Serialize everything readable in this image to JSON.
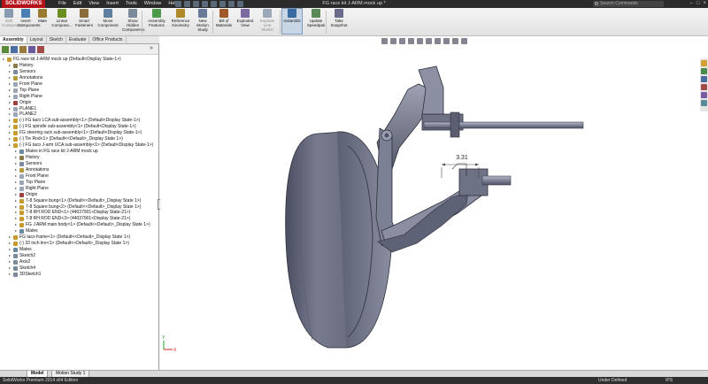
{
  "app": {
    "logo": "SOLIDWORKS",
    "doc_title": "FG race kit J-ARM mock up *",
    "search_placeholder": "Search Commands",
    "min": "–",
    "max": "□",
    "close": "×"
  },
  "menu": [
    "File",
    "Edit",
    "View",
    "Insert",
    "Tools",
    "Window",
    "Help"
  ],
  "ribbon": [
    {
      "label": "Edit\nComponent",
      "dim": true,
      "color": "#8a9bb0"
    },
    {
      "label": "Insert\nComponents",
      "color": "#4a7fb5"
    },
    {
      "label": "Mate",
      "color": "#9a7b2f"
    },
    {
      "label": "Linear\nCompone...",
      "color": "#6b8e23"
    },
    {
      "label": "Smart\nFasteners",
      "color": "#8b6b3a"
    },
    {
      "label": "Move\nComponent",
      "color": "#5f7fa0"
    },
    {
      "label": "Show\nHidden\nComponents",
      "color": "#7a8a9a"
    },
    {
      "label": "Assembly\nFeatures",
      "color": "#4c9a4c"
    },
    {
      "label": "Reference\nGeometry",
      "color": "#b08a2a"
    },
    {
      "label": "New\nMotion\nStudy",
      "color": "#6a7a9a"
    },
    {
      "label": "Bill of\nMaterials",
      "color": "#a05a2a"
    },
    {
      "label": "Exploded\nView",
      "color": "#7a6aa0"
    },
    {
      "label": "Explode\nLine\nSketch",
      "dim": true,
      "color": "#9aa8b8"
    },
    {
      "label": "Instant3D",
      "active": true,
      "color": "#3a6aa0"
    },
    {
      "label": "Update\nSpeedpak",
      "color": "#5a8a5a"
    },
    {
      "label": "Take\nSnapshot",
      "color": "#6a6a8a"
    }
  ],
  "tabs": [
    "Assembly",
    "Layout",
    "Sketch",
    "Evaluate",
    "Office Products"
  ],
  "tree": [
    {
      "label": "FG race kit J-ARM mock up  (Default<Display State-1>)",
      "lvl": 0,
      "color": "#c99a2e"
    },
    {
      "label": "History",
      "lvl": 1,
      "color": "#8a7a4a"
    },
    {
      "label": "Sensors",
      "lvl": 1,
      "color": "#7a8aa0"
    },
    {
      "label": "Annotations",
      "lvl": 1,
      "color": "#b59a3a"
    },
    {
      "label": "Front Plane",
      "lvl": 1,
      "color": "#9aa6b5"
    },
    {
      "label": "Top Plane",
      "lvl": 1,
      "color": "#9aa6b5"
    },
    {
      "label": "Right Plane",
      "lvl": 1,
      "color": "#9aa6b5"
    },
    {
      "label": "Origin",
      "lvl": 1,
      "color": "#a04040"
    },
    {
      "label": "PLANE1",
      "lvl": 1,
      "color": "#9aa6b5"
    },
    {
      "label": "PLANE2",
      "lvl": 1,
      "color": "#9aa6b5"
    },
    {
      "label": "(-) FG taco LCA sub-assembly<1> (Default<Display State-1>)",
      "lvl": 1,
      "color": "#c99a2e"
    },
    {
      "label": "(-) FG spindle sub-assembly<1> (Default<Display State-1>)",
      "lvl": 1,
      "color": "#c99a2e"
    },
    {
      "label": "FG steering rack sub-assembly<1> (Default<Display State-1>)",
      "lvl": 1,
      "color": "#c99a2e"
    },
    {
      "label": "(-) Tie Rod<1> (Default<<Default>_Display State 1>)",
      "lvl": 1,
      "color": "#c99a2e"
    },
    {
      "label": "(-) FG taco J-arm UCA sub-assembly<1> (Default<Display State-1>)",
      "lvl": 1,
      "color": "#c99a2e"
    },
    {
      "label": "Mates in FG race kit J-ARM mock up",
      "lvl": 2,
      "color": "#6a8aa0"
    },
    {
      "label": "History",
      "lvl": 2,
      "color": "#8a7a4a"
    },
    {
      "label": "Sensors",
      "lvl": 2,
      "color": "#7a8aa0"
    },
    {
      "label": "Annotations",
      "lvl": 2,
      "color": "#b59a3a"
    },
    {
      "label": "Front Plane",
      "lvl": 2,
      "color": "#9aa6b5"
    },
    {
      "label": "Top Plane",
      "lvl": 2,
      "color": "#9aa6b5"
    },
    {
      "label": "Right Plane",
      "lvl": 2,
      "color": "#9aa6b5"
    },
    {
      "label": "Origin",
      "lvl": 2,
      "color": "#a04040"
    },
    {
      "label": "7-8 Square bung<1> (Default<<Default>_Display State 1>)",
      "lvl": 2,
      "color": "#c99a2e"
    },
    {
      "label": "7-8 Square bung<2> (Default<<Default>_Display State 1>)",
      "lvl": 2,
      "color": "#c99a2e"
    },
    {
      "label": "7-8 RH ROD END<1> (44037901<Display State-21>)",
      "lvl": 2,
      "color": "#c99a2e"
    },
    {
      "label": "7-8 RH ROD END<3> (44037901<Display State-21>)",
      "lvl": 2,
      "color": "#c99a2e"
    },
    {
      "label": "FG J ARM main body<1> (Default<<Default>_Display State 1>)",
      "lvl": 2,
      "color": "#c99a2e"
    },
    {
      "label": "Mates",
      "lvl": 2,
      "color": "#6a8aa0"
    },
    {
      "label": "FG taco frame<1> (Default<<Default>_Display State 1>)",
      "lvl": 1,
      "color": "#c99a2e"
    },
    {
      "label": "(-) 33 inch tire<1> (Default<<Default>_Display State 1>)",
      "lvl": 1,
      "color": "#c99a2e"
    },
    {
      "label": "Mates",
      "lvl": 1,
      "color": "#6a8aa0"
    },
    {
      "label": "Sketch2",
      "lvl": 1,
      "color": "#7a8a9a"
    },
    {
      "label": "Axis2",
      "lvl": 1,
      "color": "#7a8a9a"
    },
    {
      "label": "Sketch4",
      "lvl": 1,
      "color": "#7a8a9a"
    },
    {
      "label": "3DSketch1",
      "lvl": 1,
      "color": "#7a8a9a"
    }
  ],
  "viewport": {
    "dimension_label": "3.31",
    "triad_y": "Y",
    "triad_x": "X"
  },
  "bottom_tabs": [
    "Model",
    "Motion Study 1"
  ],
  "status": {
    "left": "SolidWorks Premium 2014 x64 Edition",
    "middle": "Under Defined",
    "units": "IPS"
  }
}
